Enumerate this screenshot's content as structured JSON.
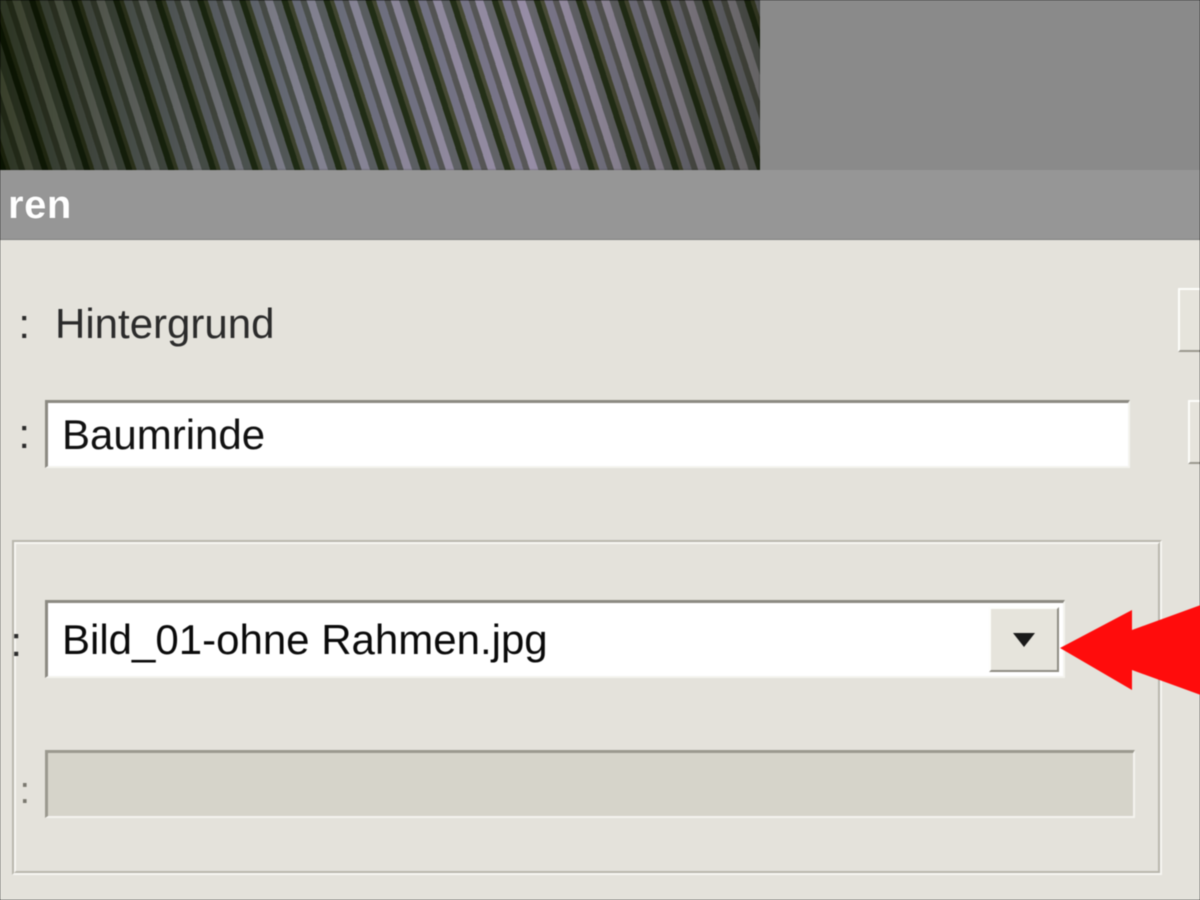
{
  "dialog": {
    "title_fragment": "ren",
    "row1": {
      "label_fragment": ":",
      "value": "Hintergrund"
    },
    "row2": {
      "label_fragment": ":",
      "value": "Baumrinde"
    },
    "row3": {
      "label_fragment": ":",
      "selected": "Bild_01-ohne Rahmen.jpg"
    },
    "row4": {
      "label_fragment": ":",
      "value": ""
    }
  },
  "colors": {
    "panel_bg": "#e4e2db",
    "titlebar_bg": "#969696",
    "arrow": "#ff0000"
  }
}
